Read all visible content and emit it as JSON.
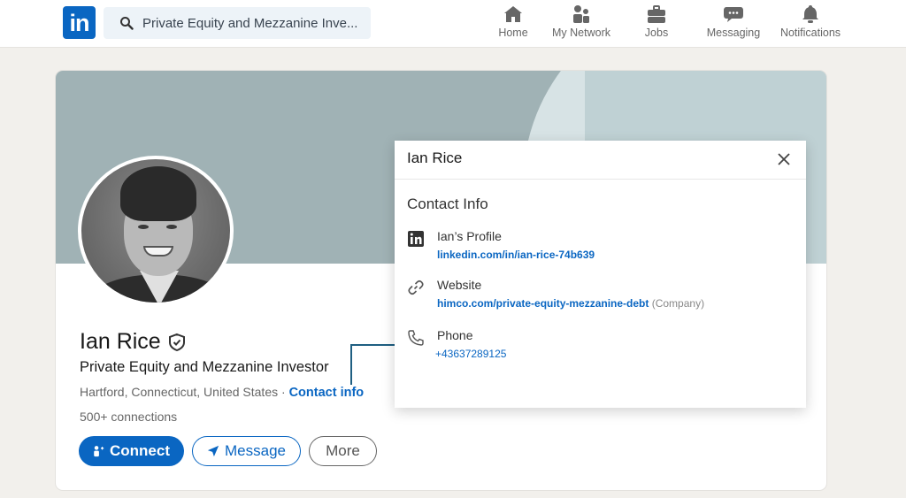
{
  "topbar": {
    "logo": "in",
    "search_value": "Private Equity and Mezzanine Inve...",
    "nav": [
      {
        "label": "Home",
        "icon": "home-icon"
      },
      {
        "label": "My Network",
        "icon": "network-icon"
      },
      {
        "label": "Jobs",
        "icon": "briefcase-icon"
      },
      {
        "label": "Messaging",
        "icon": "message-bubble-icon"
      },
      {
        "label": "Notifications",
        "icon": "bell-icon"
      }
    ]
  },
  "profile": {
    "name": "Ian Rice",
    "headline": "Private Equity and Mezzanine Investor",
    "location": "Hartford, Connecticut, United States",
    "separator": " · ",
    "contact_info_link": "Contact info",
    "connections": "500+ connections",
    "actions": {
      "connect": "Connect",
      "message": "Message",
      "more": "More"
    }
  },
  "modal": {
    "title": "Ian Rice",
    "section_title": "Contact Info",
    "items": [
      {
        "label": "Ian’s Profile",
        "value": "linkedin.com/in/ian-rice-74b639",
        "note": "",
        "icon": "linkedin-icon"
      },
      {
        "label": "Website",
        "value": "himco.com/private-equity-mezzanine-debt",
        "note": "(Company)",
        "icon": "link-icon"
      },
      {
        "label": "Phone",
        "value": "+43637289125",
        "note": "",
        "icon": "phone-icon"
      }
    ]
  },
  "colors": {
    "brand": "#0a66c2",
    "annotation_arrow": "#1f5f82"
  }
}
